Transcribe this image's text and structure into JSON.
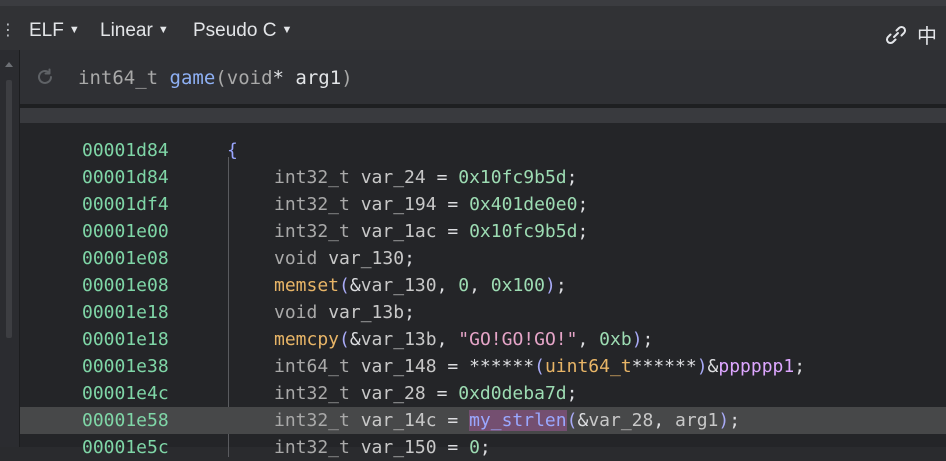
{
  "toolbar": {
    "menu1": "ELF",
    "menu2": "Linear",
    "menu3": "Pseudo C",
    "link_icon": "link-icon",
    "split_icon_char": "中"
  },
  "signature": {
    "return_type": "int64_t",
    "name": "game",
    "open": "(",
    "param_type": "void",
    "star": "*",
    "param": "arg1",
    "close": ")"
  },
  "lines": [
    {
      "addr": "00001d84",
      "text": "{"
    },
    {
      "addr": "00001d84",
      "text": "int32_t var_24 = 0x10fc9b5d;"
    },
    {
      "addr": "00001df4",
      "text": "int32_t var_194 = 0x401de0e0;"
    },
    {
      "addr": "00001e00",
      "text": "int32_t var_1ac = 0x10fc9b5d;"
    },
    {
      "addr": "00001e08",
      "text": "void var_130;"
    },
    {
      "addr": "00001e08",
      "text": "memset(&var_130, 0, 0x100);"
    },
    {
      "addr": "00001e18",
      "text": "void var_13b;"
    },
    {
      "addr": "00001e18",
      "text": "memcpy(&var_13b, \"GO!GO!GO!\", 0xb);"
    },
    {
      "addr": "00001e38",
      "text": "int64_t var_148 = ******(uint64_t******)&pppppp1;"
    },
    {
      "addr": "00001e4c",
      "text": "int32_t var_28 = 0xd0deba7d;"
    },
    {
      "addr": "00001e58",
      "text": "int32_t var_14c = my_strlen(&var_28, arg1);"
    },
    {
      "addr": "00001e5c",
      "text": "int32_t var_150 = 0;"
    }
  ],
  "selected_line": 10
}
